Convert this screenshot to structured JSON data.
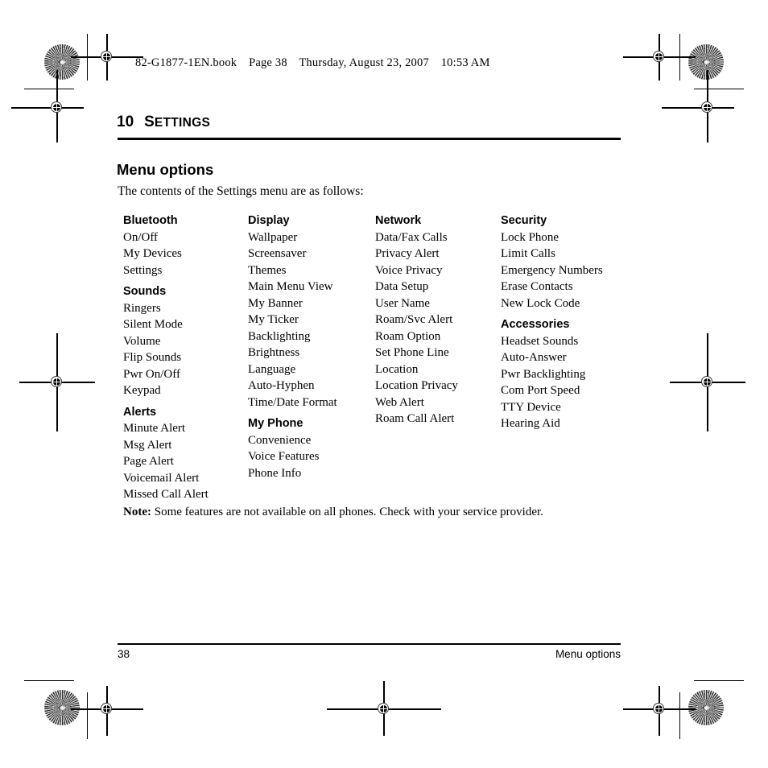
{
  "page_header": {
    "file": "82-G1877-1EN.book",
    "page": "Page 38",
    "day": "Thursday, August 23, 2007",
    "time": "10:53 AM"
  },
  "chapter": {
    "number": "10",
    "name_first_letter": "S",
    "name_rest": "ETTINGS",
    "name_full": "SETTINGS"
  },
  "section": {
    "title": "Menu options",
    "intro": "The contents of the Settings menu are as follows:"
  },
  "columns": [
    {
      "groups": [
        {
          "title": "Bluetooth",
          "items": [
            "On/Off",
            "My Devices",
            "Settings"
          ]
        },
        {
          "title": "Sounds",
          "items": [
            "Ringers",
            "Silent Mode",
            "Volume",
            "Flip Sounds",
            "Pwr On/Off",
            "Keypad"
          ]
        },
        {
          "title": "Alerts",
          "items": [
            "Minute Alert",
            "Msg Alert",
            "Page Alert",
            "Voicemail Alert",
            "Missed Call Alert"
          ]
        }
      ]
    },
    {
      "groups": [
        {
          "title": "Display",
          "items": [
            "Wallpaper",
            "Screensaver",
            "Themes",
            "Main Menu View",
            "My Banner",
            "My Ticker",
            "Backlighting",
            "Brightness",
            "Language",
            "Auto-Hyphen",
            "Time/Date Format"
          ]
        },
        {
          "title": "My Phone",
          "items": [
            "Convenience",
            "Voice Features",
            "Phone Info"
          ]
        }
      ]
    },
    {
      "groups": [
        {
          "title": "Network",
          "items": [
            "Data/Fax Calls",
            "Privacy Alert",
            "Voice Privacy",
            "Data Setup",
            "User Name",
            "Roam/Svc Alert",
            "Roam Option",
            "Set Phone Line",
            "Location",
            "Location Privacy",
            "Web Alert",
            "Roam Call Alert"
          ]
        }
      ]
    },
    {
      "groups": [
        {
          "title": "Security",
          "items": [
            "Lock Phone",
            "Limit Calls",
            "Emergency Numbers",
            "Erase Contacts",
            "New Lock Code"
          ]
        },
        {
          "title": "Accessories",
          "items": [
            "Headset Sounds",
            "Auto-Answer",
            "Pwr Backlighting",
            "Com Port Speed",
            "TTY Device",
            "Hearing Aid"
          ]
        }
      ]
    }
  ],
  "note": {
    "label": "Note:",
    "text": "Some features are not available on all phones. Check with your service provider."
  },
  "footer": {
    "page_number": "38",
    "section_name": "Menu options"
  }
}
